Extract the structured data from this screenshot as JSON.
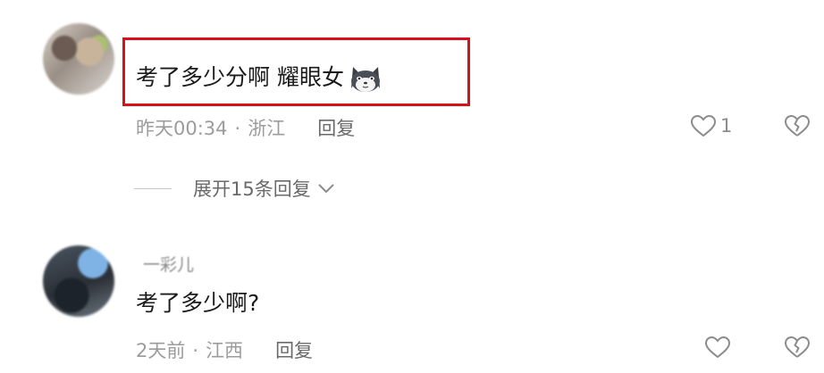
{
  "comments": [
    {
      "username": "",
      "text": "考了多少分啊 耀眼女",
      "emoji": "cat-face-icon",
      "time": "昨天00:34",
      "location": "浙江",
      "reply_label": "回复",
      "likes": "1",
      "highlighted": true,
      "expand_label": "展开15条回复"
    },
    {
      "username": "一彩儿",
      "text": "考了多少啊?",
      "time": "2天前",
      "location": "江西",
      "reply_label": "回复",
      "likes": ""
    }
  ],
  "separator": "·",
  "colors": {
    "highlight_border": "#d5121c",
    "meta_text": "#9c9c9c",
    "icon": "#8c8c8c"
  }
}
